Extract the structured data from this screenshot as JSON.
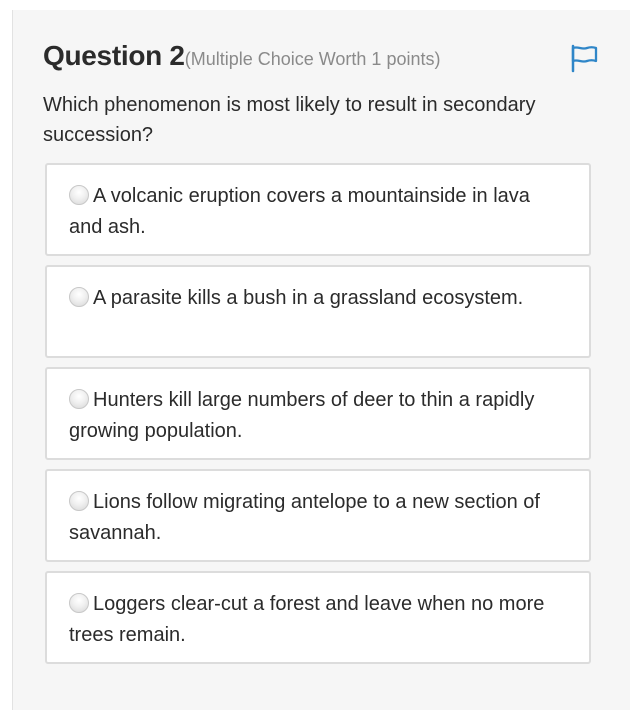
{
  "question": {
    "title": "Question 2",
    "meta": "(Multiple Choice Worth 1 points)",
    "prompt": "Which phenomenon is most likely to result in secondary succession?",
    "flag_icon": "flag-icon",
    "accent_color": "#2f86c8"
  },
  "options": [
    {
      "label": "A volcanic eruption covers a mountainside in lava and ash."
    },
    {
      "label": "A parasite kills a bush in a grassland ecosystem."
    },
    {
      "label": "Hunters kill large numbers of deer to thin a rapidly growing population."
    },
    {
      "label": "Lions follow migrating antelope to a new section of savannah."
    },
    {
      "label": "Loggers clear-cut a forest and leave when no more trees remain."
    }
  ]
}
